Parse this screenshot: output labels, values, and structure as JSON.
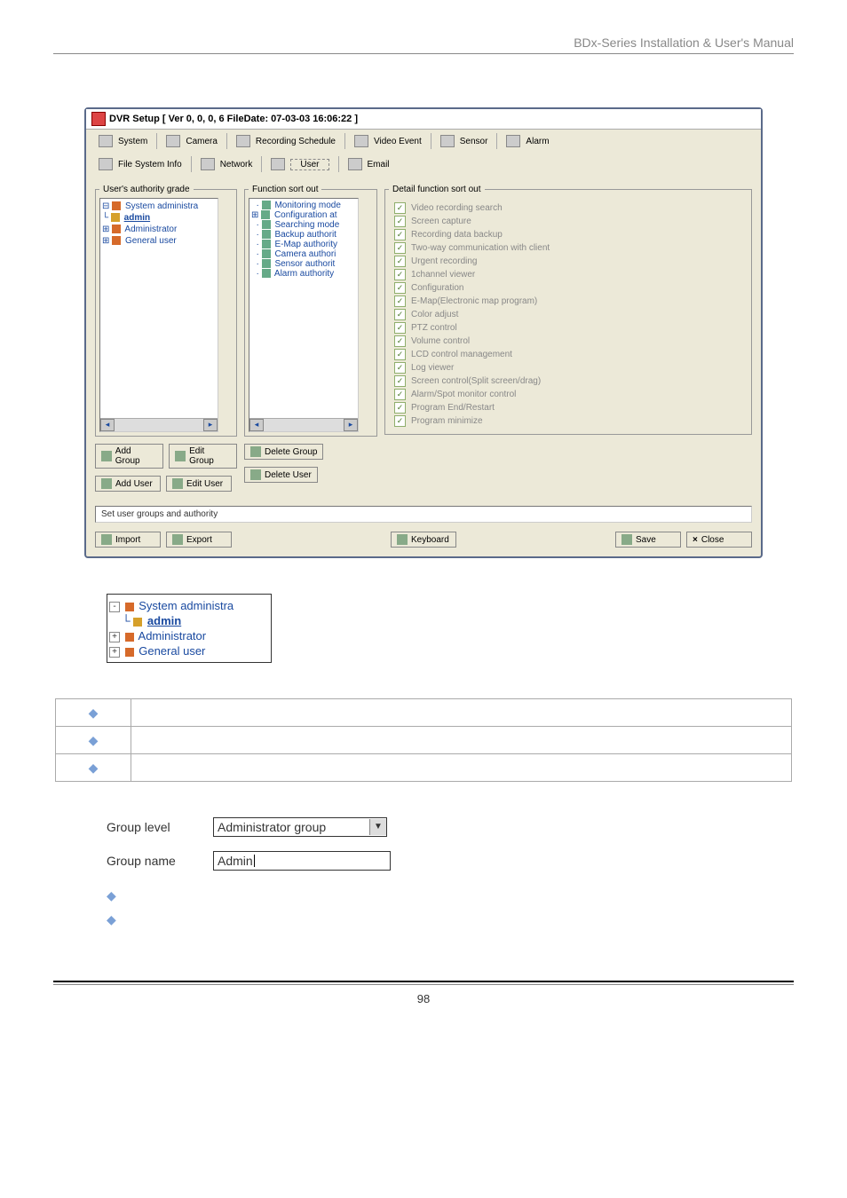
{
  "header": "BDx-Series Installation & User's Manual",
  "page_number": "98",
  "app": {
    "title": "DVR Setup [ Ver 0, 0, 0, 6   FileDate: 07-03-03 16:06:22 ]",
    "tabs_row1": [
      "System",
      "Camera",
      "Recording Schedule",
      "Video Event",
      "Sensor",
      "Alarm"
    ],
    "tabs_row2": [
      "File System Info",
      "Network",
      "User",
      "Email"
    ],
    "group_users": {
      "legend": "User's authority grade",
      "tree": [
        {
          "label": "System administra",
          "cls": "ic-grp",
          "prefix": "⊟"
        },
        {
          "label": "admin",
          "cls": "ic-usr",
          "prefix": "  └",
          "underline": true
        },
        {
          "label": "Administrator",
          "cls": "ic-grp",
          "prefix": "⊞"
        },
        {
          "label": "General user",
          "cls": "ic-grp",
          "prefix": "⊞"
        }
      ]
    },
    "group_func": {
      "legend": "Function sort out",
      "items": [
        "Monitoring mode",
        "Configuration at",
        "Searching mode",
        "Backup authorit",
        "E-Map authority",
        "Camera authori",
        "Sensor authorit",
        "Alarm authority"
      ]
    },
    "group_detail": {
      "legend": "Detail function sort out",
      "items": [
        "Video recording search",
        "Screen capture",
        "Recording data backup",
        "Two-way communication with client",
        "Urgent recording",
        "1channel viewer",
        "Configuration",
        "E-Map(Electronic map program)",
        "Color adjust",
        "PTZ control",
        "Volume control",
        "LCD control management",
        "Log viewer",
        "Screen control(Split screen/drag)",
        "Alarm/Spot monitor control",
        "Program End/Restart",
        "Program minimize"
      ]
    },
    "buttons": {
      "add_group": "Add Group",
      "edit_group": "Edit Group",
      "delete_group": "Delete Group",
      "add_user": "Add User",
      "edit_user": "Edit User",
      "delete_user": "Delete User"
    },
    "status": "Set user groups and authority",
    "bottom": {
      "import": "Import",
      "export": "Export",
      "keyboard": "Keyboard",
      "save": "Save",
      "close": "Close"
    }
  },
  "mini_tree": [
    {
      "prefix": "⊟",
      "label": "System administra",
      "cls": "ic-grp"
    },
    {
      "prefix": "  └",
      "label": "admin",
      "cls": "ic-usr",
      "underline": true
    },
    {
      "prefix": "⊞",
      "label": "Administrator",
      "cls": "ic-grp"
    },
    {
      "prefix": "⊞",
      "label": "General user",
      "cls": "ic-grp"
    }
  ],
  "form": {
    "group_level_label": "Group level",
    "group_level_value": "Administrator group",
    "group_name_label": "Group name",
    "group_name_value": "Admin"
  }
}
